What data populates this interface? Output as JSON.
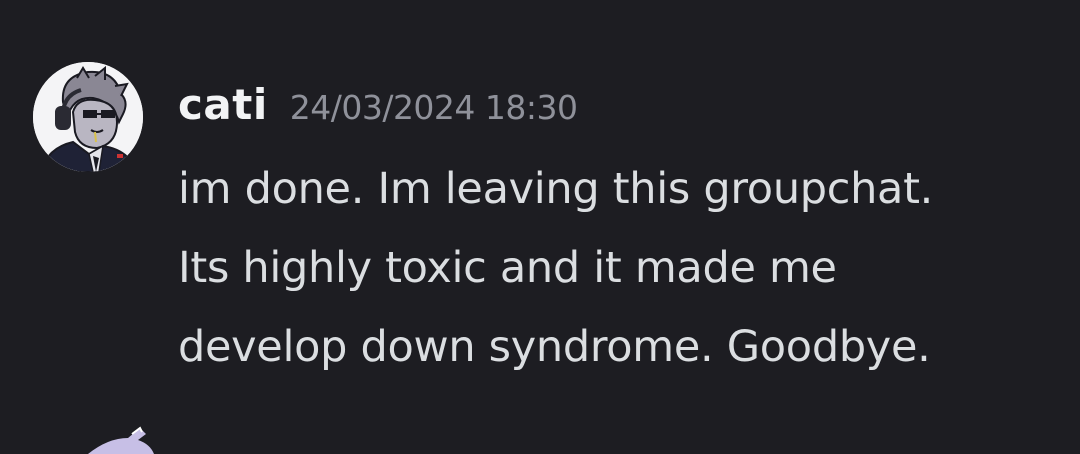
{
  "message": {
    "username": "cati",
    "timestamp": "24/03/2024 18:30",
    "lines": [
      "im done. Im leaving this groupchat.",
      "Its highly toxic and it made me",
      "develop down syndrome. Goodbye."
    ],
    "avatar_icon": "character-avatar-icon"
  },
  "colors": {
    "background": "#1d1d22",
    "username": "#f2f3f5",
    "timestamp": "#8f919a",
    "message_text": "#dbdee1"
  }
}
